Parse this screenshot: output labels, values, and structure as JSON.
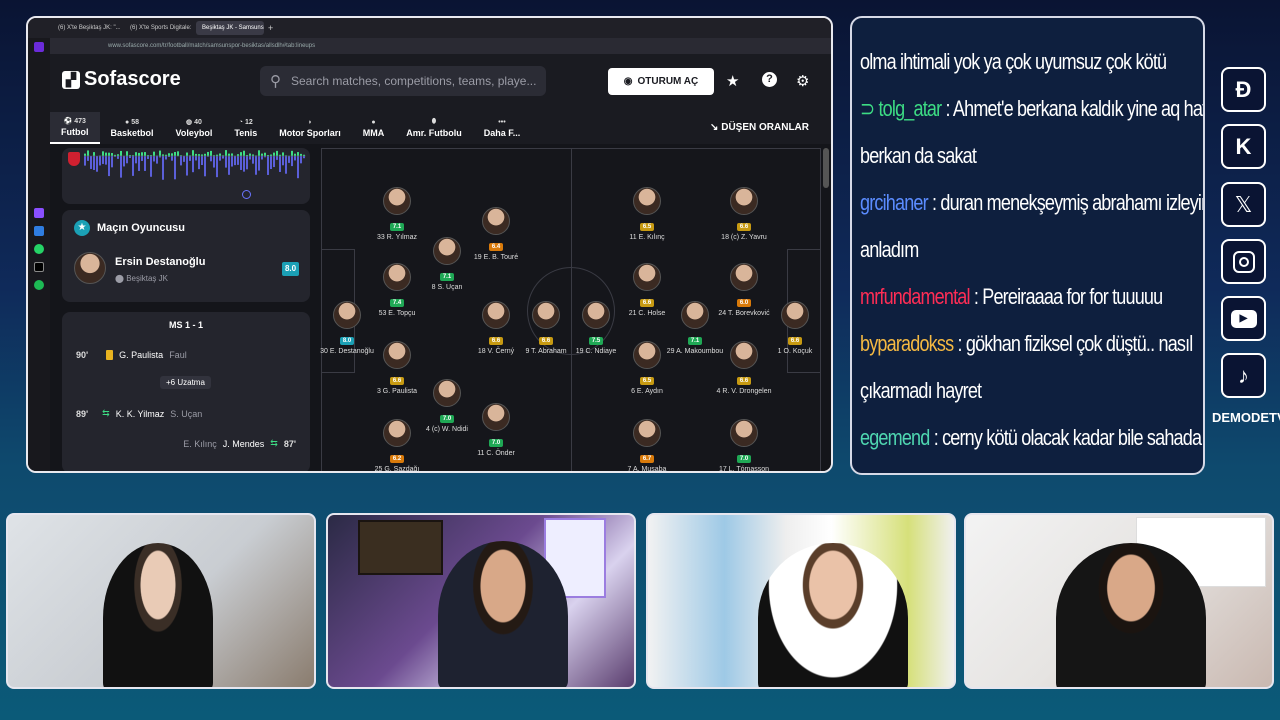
{
  "browser": {
    "tabs": [
      "(6) X'te Beşiktaş JK: \"...",
      "(6) X'te Sports Digitale: \"...",
      "Beşiktaş JK - Samsunspo..."
    ],
    "url": "www.sofascore.com/tr/football/match/samsunspor-besiktas/allsdlh#tab:lineups"
  },
  "sofascore": {
    "logo": "Sofascore",
    "search_placeholder": "Search matches, competitions, teams, playe...",
    "login": "OTURUM AÇ",
    "nav": [
      {
        "label": "Futbol",
        "count": "473"
      },
      {
        "label": "Basketbol",
        "count": "58"
      },
      {
        "label": "Voleybol",
        "count": "40"
      },
      {
        "label": "Tenis",
        "count": "12"
      },
      {
        "label": "Motor Sporları",
        "count": ""
      },
      {
        "label": "MMA",
        "count": ""
      },
      {
        "label": "Amr. Futbolu",
        "count": ""
      },
      {
        "label": "Daha F...",
        "count": ""
      }
    ],
    "odds": "DÜŞEN ORANLAR",
    "potm": {
      "title": "Maçın Oyuncusu",
      "name": "Ersin Destanoğlu",
      "team": "Beşiktaş JK",
      "rating": "8.0"
    },
    "events": {
      "header": "MS 1 - 1",
      "rows": [
        {
          "min": "90'",
          "player": "G. Paulista",
          "detail": "Faul"
        },
        {
          "extra": "+6 Uzatma"
        },
        {
          "min": "89'",
          "player": "K. K. Yilmaz",
          "detail": "S. Uçan"
        },
        {
          "min": "87'",
          "player": "J. Mendes",
          "detail": "E. Kılınç"
        }
      ]
    },
    "home_players": [
      {
        "name": "33 R. Yılmaz",
        "rating": "7.1",
        "color": "#1fa855"
      },
      {
        "name": "19 E. B. Touré",
        "rating": "6.4",
        "color": "#d97a0a"
      },
      {
        "name": "8 S. Uçan",
        "rating": "7.1",
        "color": "#1fa855"
      },
      {
        "name": "53 E. Topçu",
        "rating": "7.4",
        "color": "#1fa855"
      },
      {
        "name": "30 E. Destanoğlu",
        "rating": "8.0",
        "color": "#1ba0b5"
      },
      {
        "name": "18 V. Černý",
        "rating": "6.6",
        "color": "#c79a12"
      },
      {
        "name": "9 T. Abraham",
        "rating": "6.6",
        "color": "#c79a12"
      },
      {
        "name": "3 G. Paulista",
        "rating": "6.6",
        "color": "#c79a12"
      },
      {
        "name": "4 (c) W. Ndidi",
        "rating": "7.0",
        "color": "#1fa855"
      },
      {
        "name": "11 C. Önder",
        "rating": "7.0",
        "color": "#1fa855"
      },
      {
        "name": "25 G. Sazdağı",
        "rating": "6.2",
        "color": "#d97a0a"
      }
    ],
    "away_players": [
      {
        "name": "11 E. Kılınç",
        "rating": "6.5",
        "color": "#c79a12"
      },
      {
        "name": "18 (c) Z. Yavru",
        "rating": "6.6",
        "color": "#c79a12"
      },
      {
        "name": "21 C. Holse",
        "rating": "6.6",
        "color": "#c79a12"
      },
      {
        "name": "24 T. Borevković",
        "rating": "6.0",
        "color": "#d97a0a"
      },
      {
        "name": "19 C. Ndiaye",
        "rating": "7.5",
        "color": "#1fa855"
      },
      {
        "name": "29 A. Makoumbou",
        "rating": "7.1",
        "color": "#1fa855"
      },
      {
        "name": "1 O. Koçuk",
        "rating": "6.6",
        "color": "#c79a12"
      },
      {
        "name": "6 E. Aydın",
        "rating": "6.5",
        "color": "#c79a12"
      },
      {
        "name": "4 R. V. Drongelen",
        "rating": "6.6",
        "color": "#c79a12"
      },
      {
        "name": "7 A. Musaba",
        "rating": "6.7",
        "color": "#d97a0a"
      },
      {
        "name": "17 L. Tómasson",
        "rating": "7.0",
        "color": "#1fa855"
      }
    ]
  },
  "chat": [
    {
      "user": "",
      "text": "olma ihtimali yok ya çok uyumsuz çok kötü",
      "color": "#ffffff"
    },
    {
      "user": "tolg_atar",
      "text": ": Ahmet'e berkana kaldık yine aq hatta",
      "color": "#3ddc84"
    },
    {
      "user": "",
      "text": "berkan da sakat",
      "color": "#ffffff"
    },
    {
      "user": "grcihaner",
      "text": ": duran menekşeymiş abrahamı izleyince",
      "color": "#5b8cff"
    },
    {
      "user": "",
      "text": "anladım",
      "color": "#ffffff"
    },
    {
      "user": "mrfundamental",
      "text": ": Pereiraaaa for for tuuuuu",
      "color": "#ff2d55"
    },
    {
      "user": "byparadokss",
      "text": ": gökhan fiziksel çok düştü.. nasıl",
      "color": "#f5b942"
    },
    {
      "user": "",
      "text": "çıkarmadı hayret",
      "color": "#ffffff"
    },
    {
      "user": "egemend",
      "text": ": cerny kötü olacak kadar bile sahada yok :D",
      "color": "#4fd6b0"
    }
  ],
  "socials": {
    "icons": [
      "kick-d-icon",
      "kick-k-icon",
      "x-icon",
      "instagram-icon",
      "youtube-icon",
      "tiktok-icon"
    ],
    "handle": "DEMODETV"
  }
}
